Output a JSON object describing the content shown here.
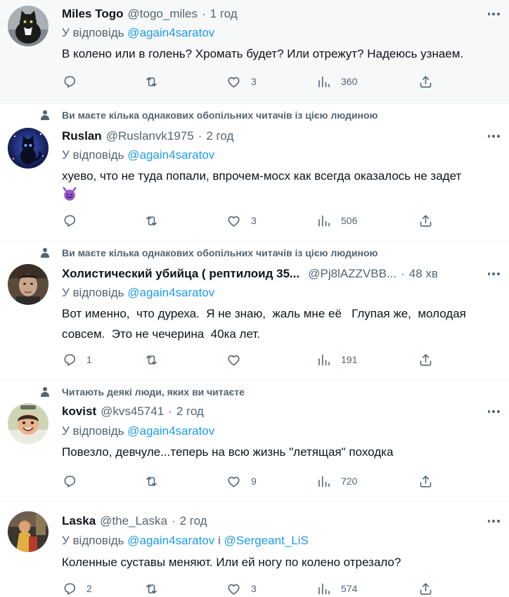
{
  "reply_prefix": "У відповідь",
  "reply_joiner": "і",
  "tweets": [
    {
      "social_context": "",
      "name": "Miles Togo",
      "handle": "@togo_miles",
      "time": "1 год",
      "reply_to": [
        "@again4saratov"
      ],
      "text": "В колено или в голень? Хромать будет? Или отрежут? Надеюсь узнаем.",
      "counts": {
        "reply": "",
        "retweet": "",
        "like": "3",
        "views": "360"
      }
    },
    {
      "social_context": "Ви маєте кілька однакових обопільних читачів із цією людиною",
      "name": "Ruslan",
      "handle": "@Ruslanvk1975",
      "time": "2 год",
      "reply_to": [
        "@again4saratov"
      ],
      "text": "хуево, что не туда попали, впрочем-мосх как всегда оказалось не задет",
      "emoji": "smiling-face-with-horns",
      "counts": {
        "reply": "",
        "retweet": "",
        "like": "3",
        "views": "506"
      }
    },
    {
      "social_context": "Ви маєте кілька однакових обопільних читачів із цією людиною",
      "name": "Холистический убийца ( рептилоид 35...",
      "handle": "@Pj8lAZZVBB...",
      "time": "48 хв",
      "reply_to": [
        "@again4saratov"
      ],
      "text": "Вот именно,  что дуреха.  Я не знаю,  жаль мне её   Глупая же,  молодая совсем.  Это не чечерина  40ка лет.",
      "counts": {
        "reply": "1",
        "retweet": "",
        "like": "",
        "views": "191"
      }
    },
    {
      "social_context": "Читають деякі люди, яких ви читаєте",
      "name": "kovist",
      "handle": "@kvs45741",
      "time": "2 год",
      "reply_to": [
        "@again4saratov"
      ],
      "text": "Повезло, девчуле...теперь на всю жизнь \"летящая\" походка",
      "counts": {
        "reply": "",
        "retweet": "",
        "like": "9",
        "views": "720"
      }
    },
    {
      "social_context": "",
      "name": "Laska",
      "handle": "@the_Laska",
      "time": "2 год",
      "reply_to": [
        "@again4saratov",
        "@Sergeant_LiS"
      ],
      "text": "Коленные суставы меняют. Или ей ногу по колено отрезало?",
      "counts": {
        "reply": "2",
        "retweet": "",
        "like": "3",
        "views": "574"
      }
    }
  ],
  "colors": {
    "link": "#1d9bf0",
    "secondary": "#536471",
    "text": "#0f1419",
    "divider": "#eff3f4"
  }
}
